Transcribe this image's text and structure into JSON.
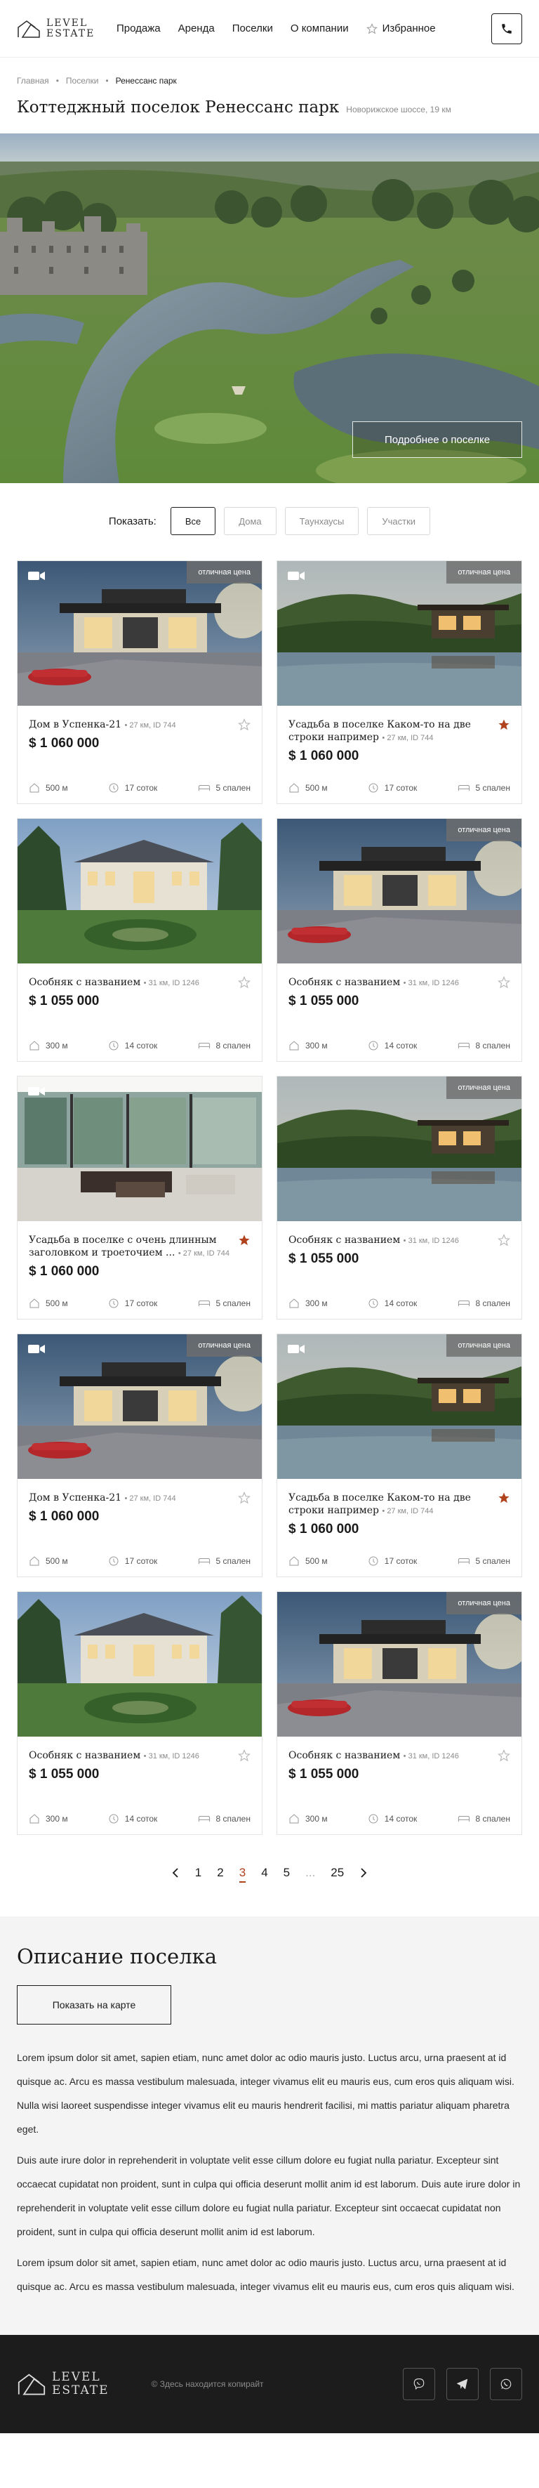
{
  "header": {
    "logo_line1": "LEVEL",
    "logo_line2": "ESTATE",
    "nav": [
      "Продажа",
      "Аренда",
      "Поселки",
      "О компании"
    ],
    "favorites": "Избранное"
  },
  "breadcrumb": [
    "Главная",
    "Поселки",
    "Ренессанс парк"
  ],
  "page": {
    "title": "Коттеджный поселок Ренессанс парк",
    "subtitle": "Новорижское шоссе, 19 км"
  },
  "hero": {
    "button": "Подробнее о поселке"
  },
  "filters": {
    "label": "Показать:",
    "options": [
      "Все",
      "Дома",
      "Таунхаусы",
      "Участки"
    ],
    "active": "Все"
  },
  "cards": [
    {
      "title": "Дом в Успенка-21",
      "meta": "27 км, ID 744",
      "price": "$ 1 060 000",
      "distance": "500 м",
      "area": "17 соток",
      "bedrooms": "5 спален",
      "badge": "отличная цена",
      "video": true,
      "fav": false,
      "scene": "modern"
    },
    {
      "title": "Усадьба в поселке Каком-то на две строки например",
      "meta": "27 км, ID 744",
      "price": "$ 1 060 000",
      "distance": "500 м",
      "area": "17 соток",
      "bedrooms": "5 спален",
      "badge": "отличная цена",
      "video": true,
      "fav": true,
      "scene": "lake"
    },
    {
      "title": "Особняк с названием",
      "meta": "31 км, ID 1246",
      "price": "$ 1 055 000",
      "distance": "300 м",
      "area": "14 соток",
      "bedrooms": "8 спален",
      "badge": "",
      "video": false,
      "fav": false,
      "scene": "manor"
    },
    {
      "title": "Особняк с названием",
      "meta": "31 км, ID 1246",
      "price": "$ 1 055 000",
      "distance": "300 м",
      "area": "14 соток",
      "bedrooms": "8 спален",
      "badge": "отличная цена",
      "video": false,
      "fav": false,
      "scene": "modern"
    },
    {
      "title": "Усадьба в поселке с очень длинным заголовком и троеточием ...",
      "meta": "27 км, ID 744",
      "price": "$ 1 060 000",
      "distance": "500 м",
      "area": "17 соток",
      "bedrooms": "5 спален",
      "badge": "",
      "video": true,
      "fav": true,
      "scene": "interior"
    },
    {
      "title": "Особняк с названием",
      "meta": "31 км, ID 1246",
      "price": "$ 1 055 000",
      "distance": "300 м",
      "area": "14 соток",
      "bedrooms": "8 спален",
      "badge": "отличная цена",
      "video": false,
      "fav": false,
      "scene": "lake"
    },
    {
      "title": "Дом в Успенка-21",
      "meta": "27 км, ID 744",
      "price": "$ 1 060 000",
      "distance": "500 м",
      "area": "17 соток",
      "bedrooms": "5 спален",
      "badge": "отличная цена",
      "video": true,
      "fav": false,
      "scene": "modern"
    },
    {
      "title": "Усадьба в поселке Каком-то на две строки например",
      "meta": "27 км, ID 744",
      "price": "$ 1 060 000",
      "distance": "500 м",
      "area": "17 соток",
      "bedrooms": "5 спален",
      "badge": "отличная цена",
      "video": true,
      "fav": true,
      "scene": "lake"
    },
    {
      "title": "Особняк с названием",
      "meta": "31 км, ID 1246",
      "price": "$ 1 055 000",
      "distance": "300 м",
      "area": "14 соток",
      "bedrooms": "8 спален",
      "badge": "",
      "video": false,
      "fav": false,
      "scene": "manor"
    },
    {
      "title": "Особняк с названием",
      "meta": "31 км, ID 1246",
      "price": "$ 1 055 000",
      "distance": "300 м",
      "area": "14 соток",
      "bedrooms": "8 спален",
      "badge": "отличная цена",
      "video": false,
      "fav": false,
      "scene": "modern"
    }
  ],
  "pagination": {
    "pages": [
      "1",
      "2",
      "3",
      "4",
      "5",
      "...",
      "25"
    ],
    "current": "3"
  },
  "description": {
    "title": "Описание поселка",
    "map_button": "Показать на карте",
    "paragraphs": [
      "Lorem ipsum dolor sit amet, sapien etiam, nunc amet dolor ac odio mauris justo. Luctus arcu, urna praesent at id quisque ac. Arcu es massa vestibulum malesuada, integer vivamus elit eu mauris eus, cum eros quis aliquam wisi. Nulla wisi laoreet suspendisse integer vivamus elit eu mauris hendrerit facilisi, mi mattis pariatur aliquam pharetra eget.",
      "Duis aute irure dolor in reprehenderit in voluptate velit esse cillum dolore eu fugiat nulla pariatur. Excepteur sint occaecat cupidatat non proident, sunt in culpa qui officia deserunt mollit anim id est laborum. Duis aute irure dolor in reprehenderit in voluptate velit esse cillum dolore eu fugiat nulla pariatur. Excepteur sint occaecat cupidatat non proident, sunt in culpa qui officia deserunt mollit anim id est laborum.",
      "Lorem ipsum dolor sit amet, sapien etiam, nunc amet dolor ac odio mauris justo. Luctus arcu, urna praesent at id quisque ac. Arcu es massa vestibulum malesuada, integer vivamus elit eu mauris eus, cum eros quis aliquam wisi."
    ]
  },
  "footer": {
    "copyright": "© Здесь находится копирайт"
  },
  "colors": {
    "accent": "#b0421e",
    "dark": "#1c1c1c",
    "light_bg": "#f4f4f4"
  }
}
